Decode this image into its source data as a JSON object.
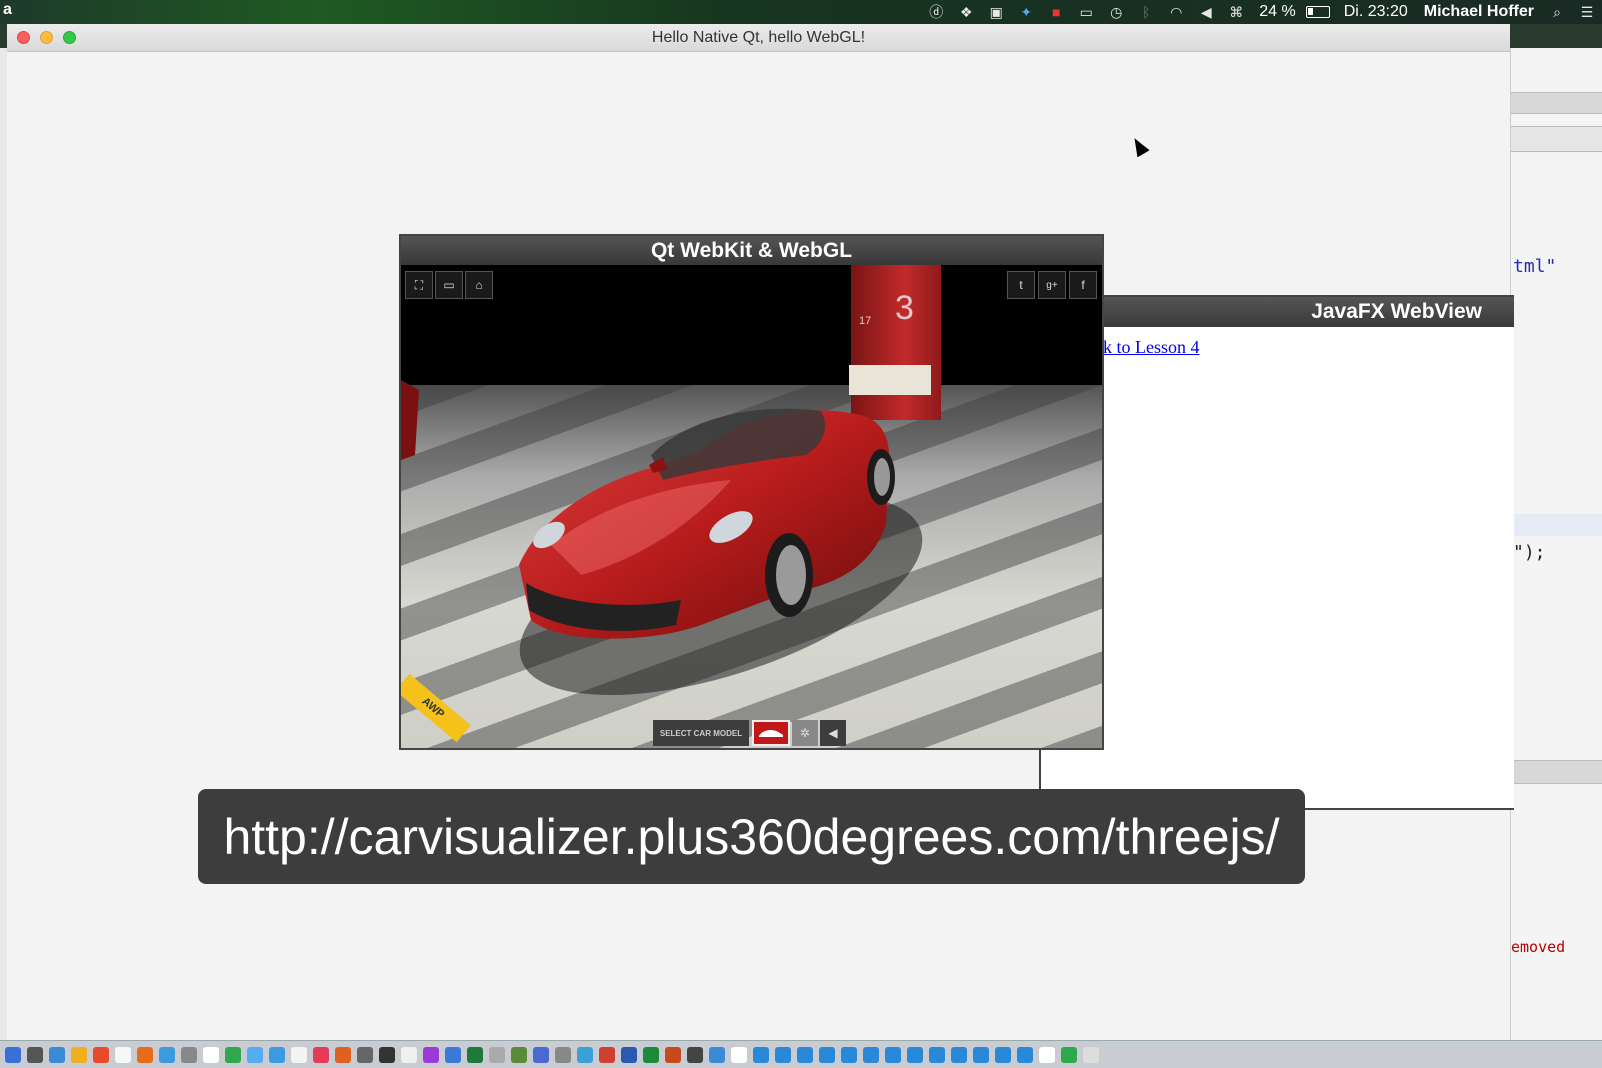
{
  "menubar": {
    "app_letter": "a",
    "battery": "24 %",
    "clock": "Di. 23:20",
    "user": "Michael Hoffer",
    "status_icons": [
      "d-icon",
      "dropbox-icon",
      "camera-icon",
      "twitter-icon",
      "red-app-icon",
      "airplay-icon",
      "time-machine-icon",
      "bluetooth-icon",
      "wifi-icon",
      "volume-icon",
      "keyboard-icon"
    ]
  },
  "window": {
    "title": "Hello Native Qt, hello WebGL!"
  },
  "qt_panel": {
    "title": "Qt WebKit & WebGL",
    "pillar_number": "3",
    "pillar_small_number": "17",
    "select_label": "SELECT CAR MODEL",
    "badge": "AWP",
    "social": [
      "twitter-icon",
      "google-plus-icon",
      "facebook-icon"
    ],
    "social_glyphs": [
      "t",
      "g+",
      "f"
    ]
  },
  "jfx_panel": {
    "title": "JavaFX WebView",
    "link": "k to Lesson 4"
  },
  "caption": {
    "url": "http://carvisualizer.plus360degrees.com/threejs/"
  },
  "editor": {
    "snippet_1": "tml\"",
    "snippet_2": "\");",
    "snippet_3": "emoved"
  },
  "colors": {
    "panel_header": "#444444",
    "car_red": "#b81c1c",
    "caption_bg": "#3d3d3d",
    "link": "#0000ee"
  }
}
